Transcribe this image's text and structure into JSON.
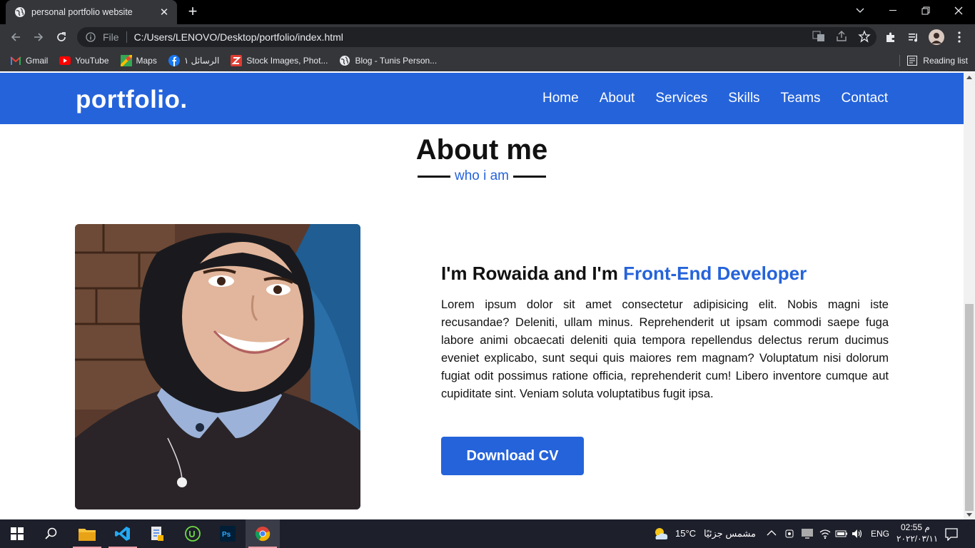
{
  "browser": {
    "tab_title": "personal portfolio website",
    "tab_close": "✕",
    "new_tab": "+",
    "omnibox_scheme": "File",
    "url": "C:/Users/LENOVO/Desktop/portfolio/index.html",
    "bookmarks": [
      {
        "label": "Gmail",
        "icon": "gmail-icon"
      },
      {
        "label": "YouTube",
        "icon": "youtube-icon"
      },
      {
        "label": "Maps",
        "icon": "maps-icon"
      },
      {
        "label": "الرسائل ١",
        "icon": "facebook-icon"
      },
      {
        "label": "Stock Images, Phot...",
        "icon": "stock-images-icon"
      },
      {
        "label": "Blog - Tunis Person...",
        "icon": "globe-icon"
      }
    ],
    "reading_list": "Reading list"
  },
  "site": {
    "logo": "portfolio.",
    "nav": [
      "Home",
      "About",
      "Services",
      "Skills",
      "Teams",
      "Contact"
    ],
    "accent_color": "#2563da"
  },
  "about": {
    "title": "About me",
    "subtitle": "who i am",
    "heading_prefix": "I'm Rowaida and I'm ",
    "heading_accent": "Front-End Developer",
    "body": "Lorem ipsum dolor sit amet consectetur adipisicing elit. Nobis magni iste recusandae? Deleniti, ullam minus. Reprehenderit ut ipsam commodi saepe fuga labore animi obcaecati deleniti quia tempora repellendus delectus rerum ducimus eveniet explicabo, sunt sequi quis maiores rem magnam? Voluptatum nisi dolorum fugiat odit possimus ratione officia, reprehenderit cum! Libero inventore cumque aut cupiditate sint. Veniam soluta voluptatibus fugit ipsa.",
    "cv_button": "Download CV"
  },
  "taskbar": {
    "weather_temp": "15°C",
    "weather_desc": "مشمس جزئيًا",
    "language": "ENG",
    "time": "02:55 م",
    "date": "٢٠٢٢/٠٣/١١"
  }
}
